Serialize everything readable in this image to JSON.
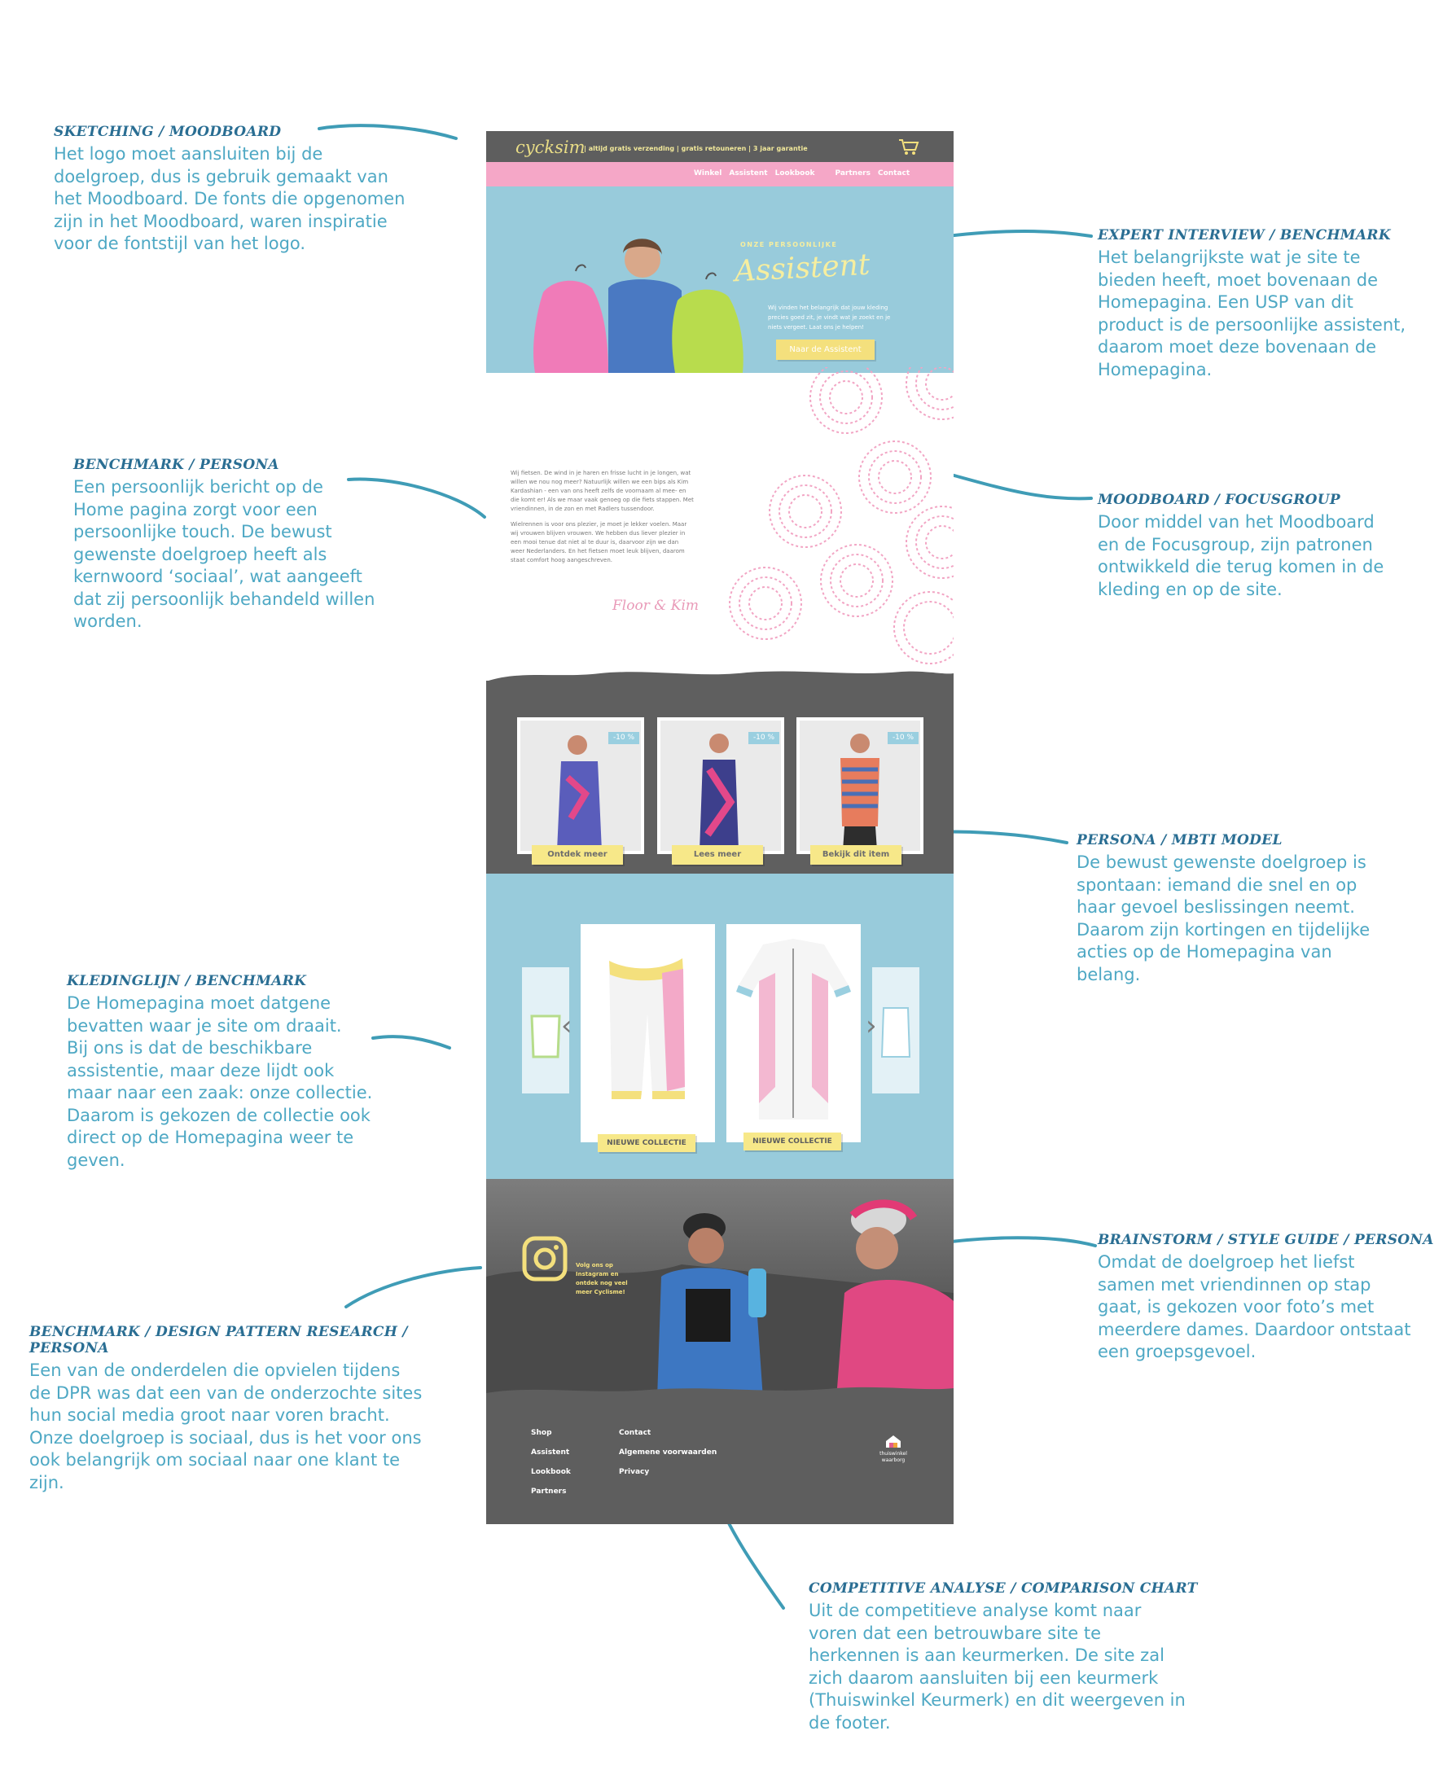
{
  "annotations": {
    "sketching": {
      "heading": "SKETCHING / MOODBOARD",
      "lines": [
        "Het logo moet aansluiten bij de",
        "doelgroep, dus is gebruik gemaakt van",
        "het Moodboard. De fonts die opgenomen",
        "zijn in het Moodboard, waren inspiratie",
        "voor de fontstijl van het logo."
      ]
    },
    "expert": {
      "heading": "EXPERT INTERVIEW / BENCHMARK",
      "lines": [
        "Het belangrijkste wat je site te",
        "bieden heeft, moet bovenaan de",
        "Homepagina. Een USP van dit",
        "product is de persoonlijke assistent,",
        "daarom moet deze bovenaan de",
        "Homepagina."
      ]
    },
    "benchmark_persona": {
      "heading": "BENCHMARK / PERSONA",
      "lines": [
        "Een persoonlijk bericht op de",
        "Home pagina zorgt voor een",
        "persoonlijke touch. De bewust",
        "gewenste doelgroep heeft als",
        "kernwoord ‘sociaal’, wat aangeeft",
        "dat zij persoonlijk behandeld willen",
        "worden."
      ]
    },
    "moodboard_focus": {
      "heading": "MOODBOARD / FOCUSGROUP",
      "lines": [
        "Door middel van het Moodboard",
        "en de Focusgroup, zijn patronen",
        "ontwikkeld die terug komen in de",
        "kleding en op de site."
      ]
    },
    "persona_mbti": {
      "heading": "PERSONA / MBTI MODEL",
      "lines": [
        "De bewust gewenste doelgroep is",
        "spontaan: iemand die snel en op",
        "haar gevoel beslissingen neemt.",
        "Daarom zijn kortingen en tijdelijke",
        "acties op de Homepagina van",
        "belang."
      ]
    },
    "kledinglijn": {
      "heading": "KLEDINGLIJN / BENCHMARK",
      "lines": [
        "De Homepagina moet datgene",
        "bevatten waar je site om draait.",
        "Bij ons is dat de beschikbare",
        "assistentie, maar deze lijdt ook",
        "maar naar een zaak: onze collectie.",
        "Daarom is gekozen de collectie ook",
        "direct op de Homepagina weer te",
        "geven."
      ]
    },
    "brainstorm": {
      "heading": "BRAINSTORM / STYLE GUIDE / PERSONA",
      "lines": [
        "Omdat de doelgroep het liefst",
        "samen met vriendinnen op stap",
        "gaat, is gekozen voor foto’s met",
        "meerdere dames. Daardoor ontstaat",
        "een groepsgevoel."
      ]
    },
    "dpr": {
      "heading": "BENCHMARK / DESIGN PATTERN RESEARCH / PERSONA",
      "lines": [
        "Een van de onderdelen die opvielen tijdens",
        "de DPR was dat een van de onderzochte sites",
        "hun social media groot naar voren bracht.",
        "Onze doelgroep is sociaal, dus is het voor ons",
        "ook belangrijk om sociaal naar one klant te",
        "zijn."
      ]
    },
    "competitive": {
      "heading": "COMPETITIVE ANALYSE / COMPARISON CHART",
      "lines": [
        "Uit de competitieve analyse komt naar",
        "voren dat een betrouwbare site te",
        "herkennen is aan keurmerken. De site zal",
        "zich daarom aansluiten bij een keurmerk",
        "(Thuiswinkel Keurmerk) en dit weergeven in",
        "de footer."
      ]
    }
  },
  "mockup": {
    "logo": "cycksim",
    "tagline": "| altijd gratis verzending | gratis retouneren | 3 jaar garantie",
    "nav": [
      "Winkel",
      "Assistent",
      "Lookbook",
      "Partners",
      "Contact"
    ],
    "hero": {
      "kicker": "ONZE PERSOONLIJKE",
      "title": "Assistent",
      "text": "Wij vinden het belangrijk dat jouw kleding precies goed zit, je vindt wat je zoekt en je niets vergeet. Laat ons je helpen!",
      "button": "Naar de Assistent"
    },
    "story": {
      "paragraphs": [
        "Wij fietsen. De wind in je haren en frisse lucht in je longen, wat willen we nou nog meer? Natuurlijk willen we een bips als Kim Kardashian - een van ons heeft zelfs de voornaam al mee- en die komt er! Als we maar vaak genoeg op die fiets stappen. Met vriendinnen, in de zon en met Radlers tussendoor.",
        "Wielrennen is voor ons plezier, je moet je lekker voelen. Maar wij vrouwen blijven vrouwen. We hebben dus liever plezier in een mooi tenue dat niet al te duur is, daarvoor zijn we dan weer Nederlanders. En het fietsen moet leuk blijven, daarom staat comfort hoog aangeschreven."
      ],
      "signature": "Floor & Kim"
    },
    "sale": {
      "items": [
        {
          "discount": "-10 %",
          "button": "Ontdek meer"
        },
        {
          "discount": "-10 %",
          "button": "Lees meer"
        },
        {
          "discount": "-10 %",
          "button": "Bekijk dit item"
        }
      ]
    },
    "collection": {
      "buttons": [
        "NIEUWE COLLECTIE",
        "NIEUWE COLLECTIE"
      ],
      "prev": "‹",
      "next": "›"
    },
    "instagram": {
      "text": "Volg ons op Instagram en ontdek nog veel meer Cyclisme!"
    },
    "footer": {
      "col1": [
        "Shop",
        "Assistent",
        "Lookbook",
        "Partners"
      ],
      "col2": [
        "Contact",
        "Algemene voorwaarden",
        "Privacy"
      ],
      "badge": [
        "thuiswinkel",
        "waarborg"
      ]
    }
  }
}
